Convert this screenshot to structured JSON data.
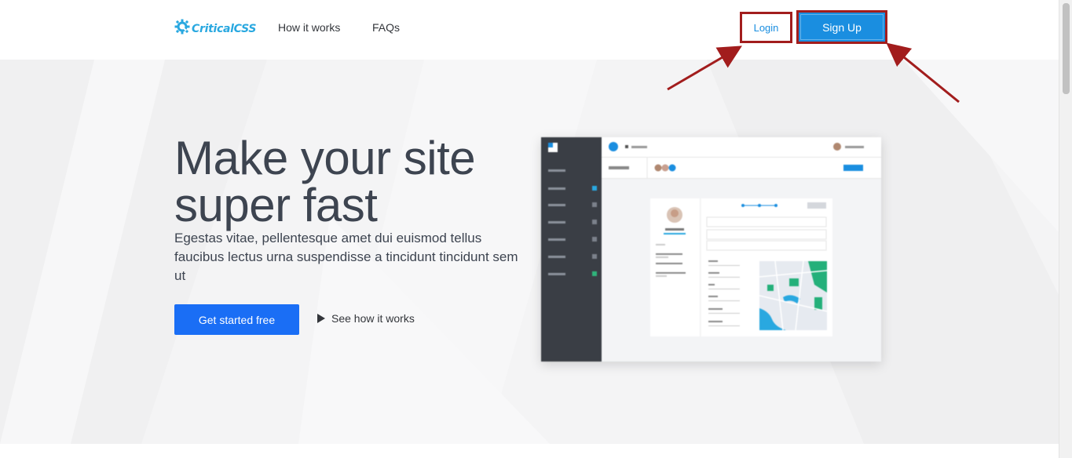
{
  "header": {
    "logo_text": "CriticalCSS",
    "nav": {
      "how_it_works": "How it works",
      "faqs": "FAQs"
    },
    "login_label": "Login",
    "signup_label": "Sign Up"
  },
  "hero": {
    "headline_line1": "Make your site",
    "headline_line2": "super fast",
    "subtext": "Egestas vitae, pellentesque amet dui euismod tellus faucibus lectus urna suspendisse a tincidunt tincidunt sem ut",
    "cta_label": "Get started free",
    "secondary_label": "See how it works"
  },
  "colors": {
    "brand_blue": "#1a8ee0",
    "cta_blue": "#1a6ef5",
    "annotation_red": "#a21d1d",
    "text_dark": "#3d4450"
  },
  "icons": {
    "logo": "gear-icon",
    "play": "play-icon"
  }
}
